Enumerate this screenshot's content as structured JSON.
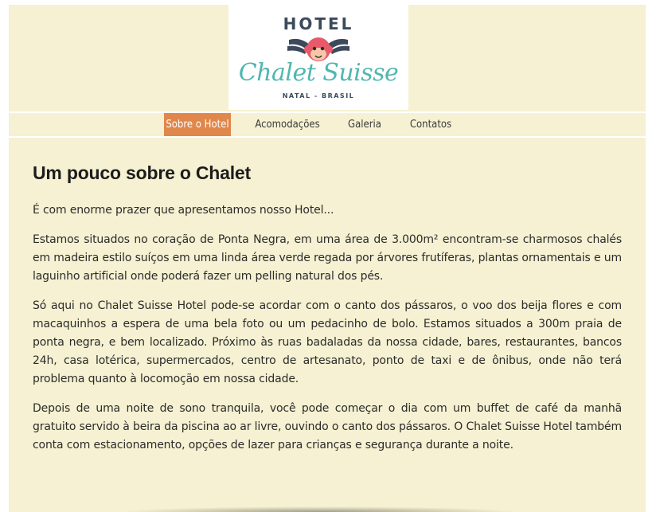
{
  "logo": {
    "top_text": "HOTEL",
    "brand_name": "Chalet Suisse",
    "subtitle": "NATAL - BRASIL",
    "icon": "monkey-mascot-icon",
    "colors": {
      "brand": "#4fb7b0",
      "dark": "#3d4a5c",
      "mascot": "#e85a6a"
    }
  },
  "nav": {
    "items": [
      {
        "label": "Sobre o Hotel",
        "active": true
      },
      {
        "label": "Acomodações",
        "active": false
      },
      {
        "label": "Galeria",
        "active": false
      },
      {
        "label": "Contatos",
        "active": false
      }
    ],
    "active_color": "#e0874b"
  },
  "main": {
    "title": "Um pouco sobre o Chalet",
    "paragraphs": [
      "É com enorme prazer que apresentamos nosso Hotel...",
      "Estamos situados no coração de Ponta Negra, em uma área de 3.000m² encontram-se charmosos chalés em madeira estilo suíços em uma linda área verde regada por árvores frutíferas, plantas ornamentais e um laguinho artificial onde poderá fazer um pelling natural dos pés.",
      "Só aqui no Chalet Suisse Hotel pode-se acordar com o canto dos pássaros, o voo dos beija flores e com macaquinhos a espera de uma bela foto ou um pedacinho de bolo. Estamos situados a 300m praia de ponta negra, e bem localizado. Próximo às ruas badaladas da nossa cidade, bares, restaurantes, bancos 24h, casa lotérica, supermercados, centro de artesanato, ponto de taxi e de ônibus, onde não terá problema quanto à locomoção em nossa cidade.",
      "Depois de uma noite de sono tranquila, você pode começar o dia com um buffet de café da manhã gratuito servido à beira da piscina ao ar livre, ouvindo o canto dos pássaros. O Chalet Suisse Hotel também conta com estacionamento, opções de lazer para crianças e segurança durante a noite."
    ]
  },
  "colors": {
    "background": "#f5f1d2"
  }
}
